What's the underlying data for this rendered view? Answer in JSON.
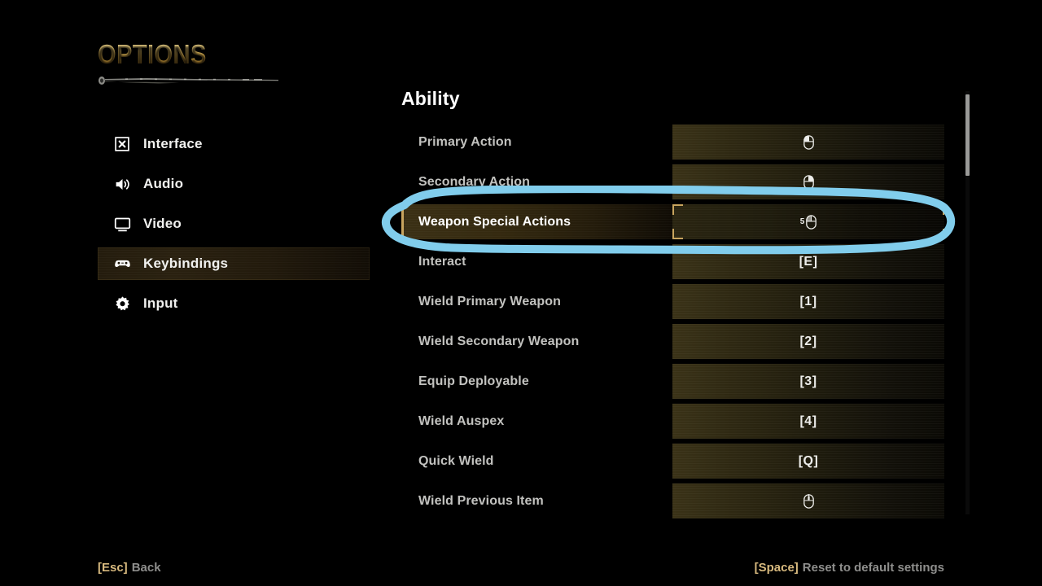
{
  "header": {
    "title": "OPTIONS"
  },
  "sidebar": {
    "items": [
      {
        "id": "interface",
        "label": "Interface",
        "icon": "x-box-icon",
        "selected": false
      },
      {
        "id": "audio",
        "label": "Audio",
        "icon": "speaker-icon",
        "selected": false
      },
      {
        "id": "video",
        "label": "Video",
        "icon": "monitor-icon",
        "selected": false
      },
      {
        "id": "keybindings",
        "label": "Keybindings",
        "icon": "gamepad-icon",
        "selected": true
      },
      {
        "id": "input",
        "label": "Input",
        "icon": "gear-icon",
        "selected": false
      }
    ]
  },
  "main": {
    "section_title": "Ability",
    "rows": [
      {
        "label": "Primary Action",
        "value": "",
        "value_icon": "mouse-left-button-icon",
        "selected": false
      },
      {
        "label": "Secondary Action",
        "value": "",
        "value_icon": "mouse-right-button-icon",
        "selected": false
      },
      {
        "label": "Weapon Special Actions",
        "value": "5",
        "value_icon": "mouse-button-5-icon",
        "selected": true
      },
      {
        "label": "Interact",
        "value": "[E]",
        "value_icon": "",
        "selected": false
      },
      {
        "label": "Wield Primary Weapon",
        "value": "[1]",
        "value_icon": "",
        "selected": false
      },
      {
        "label": "Wield Secondary Weapon",
        "value": "[2]",
        "value_icon": "",
        "selected": false
      },
      {
        "label": "Equip Deployable",
        "value": "[3]",
        "value_icon": "",
        "selected": false
      },
      {
        "label": "Wield Auspex",
        "value": "[4]",
        "value_icon": "",
        "selected": false
      },
      {
        "label": "Quick Wield",
        "value": "[Q]",
        "value_icon": "",
        "selected": false
      },
      {
        "label": "Wield Previous Item",
        "value": "",
        "value_icon": "mouse-middle-button-icon",
        "selected": false
      }
    ]
  },
  "footer": {
    "back_key": "[Esc]",
    "back_label": "Back",
    "reset_key": "[Space]",
    "reset_label": "Reset to default settings"
  },
  "annotation": {
    "shape": "hand-drawn-ellipse",
    "color": "#81cdec",
    "target": "Weapon Special Actions"
  },
  "colors": {
    "gold": "#c8a45e",
    "title_gold": "#e2c473",
    "annotation_blue": "#81cdec",
    "background": "#000000",
    "label_gray": "#c2c2bf"
  }
}
